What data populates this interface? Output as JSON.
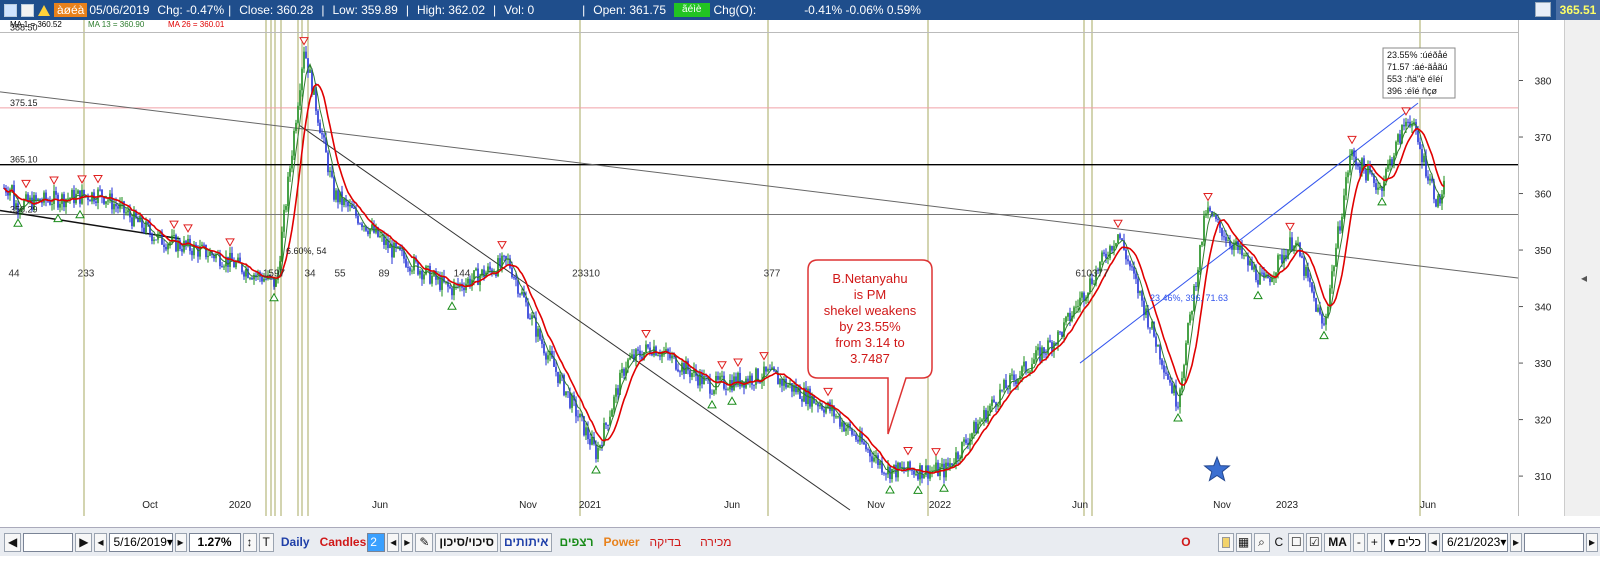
{
  "header": {
    "symbol": "àøéà",
    "date": "05/06/2019",
    "chg": "Chg: -0.47%",
    "close": "Close: 360.28",
    "low": "Low: 359.89",
    "high": "High: 362.02",
    "vol": "Vol: 0",
    "open": "Open: 361.75",
    "green_tag": "ãéìè",
    "chgo_label": "Chg(O):",
    "chgo_values": "-0.41% -0.06% 0.59%",
    "last_price": "365.51"
  },
  "legend": {
    "ma1": "MA 1 = 360.52",
    "ma13": "MA 13 = 360.90",
    "ma26": "MA 26 = 360.01"
  },
  "level_labels": {
    "l388": "388.50",
    "l375": "375.15",
    "l365": "365.10",
    "l356": "356.29"
  },
  "stats_box": [
    "23.55% :úéðåé",
    "71.57 :áé-ãåãú",
    "553 :ñä\"è éîéí",
    "396 :éîé ñçø"
  ],
  "annotation": "B.Netanyahu\nis PM\nshekel weakens\nby 23.55%\nfrom 3.14  to\n3.7487",
  "chart_data": {
    "type": "candlestick",
    "symbol": "àøéà",
    "y_ticks": [
      310,
      320,
      330,
      340,
      350,
      360,
      370,
      380
    ],
    "ylim": [
      304,
      390
    ],
    "x_ticks": [
      "Oct",
      "2020",
      "Jun",
      "Nov",
      "2021",
      "Jun",
      "Nov",
      "2022",
      "Jun",
      "Nov",
      "2023",
      "Jun"
    ],
    "cycle_labels": [
      "44",
      "233",
      "1597",
      "34",
      "55",
      "89",
      "144",
      "23310",
      "377",
      "610377"
    ],
    "horizontal_levels": [
      388.5,
      375.15,
      365.1,
      356.29
    ],
    "trend_annotation": "23.46%, 396, 71.63",
    "trend_annotation2": "6.60%, 54",
    "price_path": [
      {
        "t": "2019-05",
        "v": 358
      },
      {
        "t": "2019-08",
        "v": 360
      },
      {
        "t": "2019-10",
        "v": 352
      },
      {
        "t": "2019-12",
        "v": 349
      },
      {
        "t": "2020-02",
        "v": 344
      },
      {
        "t": "2020-03",
        "v": 386
      },
      {
        "t": "2020-04",
        "v": 360
      },
      {
        "t": "2020-06",
        "v": 350
      },
      {
        "t": "2020-08",
        "v": 343
      },
      {
        "t": "2020-10",
        "v": 348
      },
      {
        "t": "2020-11",
        "v": 335
      },
      {
        "t": "2021-01",
        "v": 314
      },
      {
        "t": "2021-02",
        "v": 330
      },
      {
        "t": "2021-03",
        "v": 333
      },
      {
        "t": "2021-05",
        "v": 326
      },
      {
        "t": "2021-07",
        "v": 328
      },
      {
        "t": "2021-09",
        "v": 322
      },
      {
        "t": "2021-11",
        "v": 311
      },
      {
        "t": "2022-01",
        "v": 311
      },
      {
        "t": "2022-03",
        "v": 325
      },
      {
        "t": "2022-05",
        "v": 335
      },
      {
        "t": "2022-07",
        "v": 353
      },
      {
        "t": "2022-09",
        "v": 323
      },
      {
        "t": "2022-10",
        "v": 357
      },
      {
        "t": "2022-12",
        "v": 344
      },
      {
        "t": "2023-01",
        "v": 352
      },
      {
        "t": "2023-02",
        "v": 336
      },
      {
        "t": "2023-03",
        "v": 367
      },
      {
        "t": "2023-04",
        "v": 361
      },
      {
        "t": "2023-05",
        "v": 374
      },
      {
        "t": "2023-06",
        "v": 358
      },
      {
        "t": "2023-06-21",
        "v": 361
      }
    ]
  },
  "bottombar": {
    "date_from": "5/16/2019",
    "percent": "1.27%",
    "tool_t": "T",
    "daily": "Daily",
    "candles": "Candles",
    "candles_n": "2",
    "tab1": "סיכוי/סיכון",
    "tab2": "איתותים",
    "tab3": "רצפים",
    "tab4": "Power",
    "tab5": "בדיקה",
    "tab6": "מכירה",
    "o_btn": "O",
    "c_btn": "C",
    "ma_label": "MA",
    "tools_select": "כלים",
    "date_to": "6/21/2023"
  },
  "colors": {
    "header_bg": "#1f4e8c",
    "up_candle": "#1a8c1a",
    "down_candle": "#1f2fd6",
    "ma13": "#2e7d2e",
    "ma26": "#e00000",
    "annotation_border": "#d33"
  }
}
